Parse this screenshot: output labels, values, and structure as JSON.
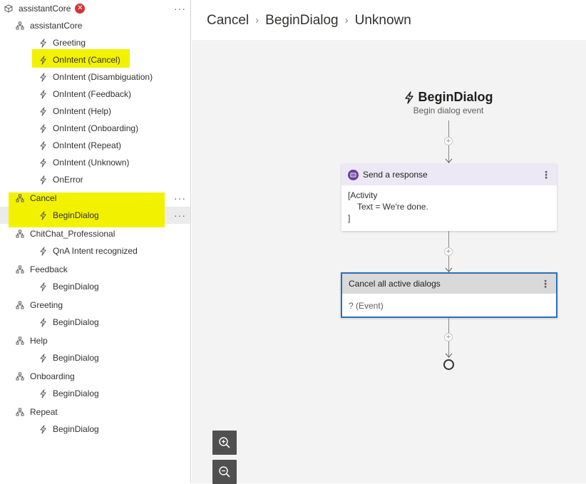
{
  "sidebar": {
    "root": {
      "label": "assistantCore",
      "icon": "cube-icon",
      "close_icon": "close-icon",
      "more_icon": "more-icon"
    },
    "items": [
      {
        "label": "assistantCore",
        "icon": "dialog-icon",
        "level": 1
      },
      {
        "label": "Greeting",
        "icon": "lightning-icon",
        "level": 2
      },
      {
        "label": "OnIntent (Cancel)",
        "icon": "lightning-icon",
        "level": 2,
        "highlighted": true
      },
      {
        "label": "OnIntent (Disambiguation)",
        "icon": "lightning-icon",
        "level": 2
      },
      {
        "label": "OnIntent (Feedback)",
        "icon": "lightning-icon",
        "level": 2
      },
      {
        "label": "OnIntent (Help)",
        "icon": "lightning-icon",
        "level": 2
      },
      {
        "label": "OnIntent (Onboarding)",
        "icon": "lightning-icon",
        "level": 2
      },
      {
        "label": "OnIntent (Repeat)",
        "icon": "lightning-icon",
        "level": 2
      },
      {
        "label": "OnIntent (Unknown)",
        "icon": "lightning-icon",
        "level": 2
      },
      {
        "label": "OnError",
        "icon": "lightning-icon",
        "level": 2
      },
      {
        "label": "Cancel",
        "icon": "dialog-icon",
        "level": 1,
        "highlighted": true
      },
      {
        "label": "BeginDialog",
        "icon": "lightning-icon",
        "level": 2,
        "highlighted": true,
        "selected": true
      },
      {
        "label": "ChitChat_Professional",
        "icon": "dialog-icon",
        "level": 1
      },
      {
        "label": "QnA Intent recognized",
        "icon": "lightning-icon",
        "level": 2
      },
      {
        "label": "Feedback",
        "icon": "dialog-icon",
        "level": 1
      },
      {
        "label": "BeginDialog",
        "icon": "lightning-icon",
        "level": 2
      },
      {
        "label": "Greeting",
        "icon": "dialog-icon",
        "level": 1
      },
      {
        "label": "BeginDialog",
        "icon": "lightning-icon",
        "level": 2
      },
      {
        "label": "Help",
        "icon": "dialog-icon",
        "level": 1
      },
      {
        "label": "BeginDialog",
        "icon": "lightning-icon",
        "level": 2
      },
      {
        "label": "Onboarding",
        "icon": "dialog-icon",
        "level": 1
      },
      {
        "label": "BeginDialog",
        "icon": "lightning-icon",
        "level": 2
      },
      {
        "label": "Repeat",
        "icon": "dialog-icon",
        "level": 1
      },
      {
        "label": "BeginDialog",
        "icon": "lightning-icon",
        "level": 2
      }
    ]
  },
  "breadcrumb": [
    "Cancel",
    "BeginDialog",
    "Unknown"
  ],
  "canvas": {
    "trigger": {
      "title": "BeginDialog",
      "subtitle": "Begin dialog event",
      "icon": "lightning-icon"
    },
    "send_response": {
      "title": "Send a response",
      "icon": "bot-message-icon",
      "body_lines": [
        "[Activity",
        "Text = We're done.",
        "]"
      ],
      "accent": "#ece8f5"
    },
    "cancel_dialogs": {
      "title": "Cancel all active dialogs",
      "body": "? (Event)",
      "border": "#2e6fb8"
    },
    "zoom_in_icon": "zoom-in-icon",
    "zoom_out_icon": "zoom-out-icon"
  },
  "colors": {
    "highlight": "#f2f200",
    "selected_row": "#ebebeb",
    "canvas_bg": "#f3f3f3"
  }
}
